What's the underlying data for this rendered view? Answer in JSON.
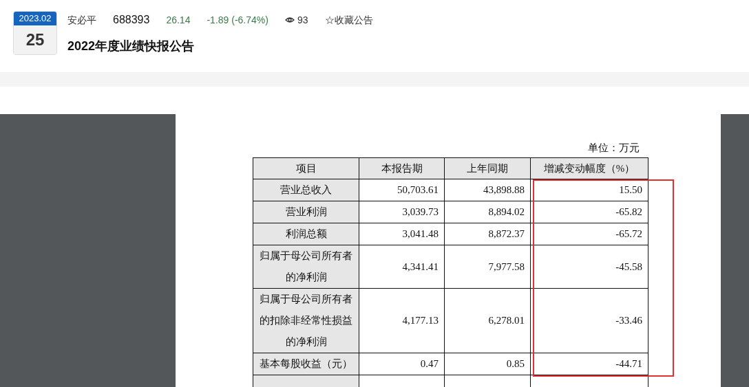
{
  "header": {
    "date_month": "2023.02",
    "date_day": "25",
    "company": "安必平",
    "code": "688393",
    "price": "26.14",
    "change": "-1.89 (-6.74%)",
    "views": "93",
    "favorite": "☆收藏公告",
    "title": "2022年度业绩快报公告"
  },
  "document": {
    "unit": "单位：万元",
    "table": {
      "columns": [
        "项目",
        "本报告期",
        "上年同期",
        "增减变动幅度（%）"
      ],
      "rows": [
        {
          "cells": [
            "营业总收入",
            "50,703.61",
            "43,898.88",
            "15.50"
          ]
        },
        {
          "cells": [
            "营业利润",
            "3,039.73",
            "8,894.02",
            "-65.82"
          ]
        },
        {
          "cells": [
            "利润总额",
            "3,041.48",
            "8,872.37",
            "-65.72"
          ]
        },
        {
          "cells": [
            "归属于母公司所有者的净利润",
            "4,341.41",
            "7,977.58",
            "-45.58"
          ]
        },
        {
          "cells": [
            "归属于母公司所有者的扣除非经常性损益的净利润",
            "4,177.13",
            "6,278.01",
            "-33.46"
          ]
        },
        {
          "cells": [
            "基本每股收益（元）",
            "0.47",
            "0.85",
            "-44.71"
          ]
        }
      ]
    }
  }
}
